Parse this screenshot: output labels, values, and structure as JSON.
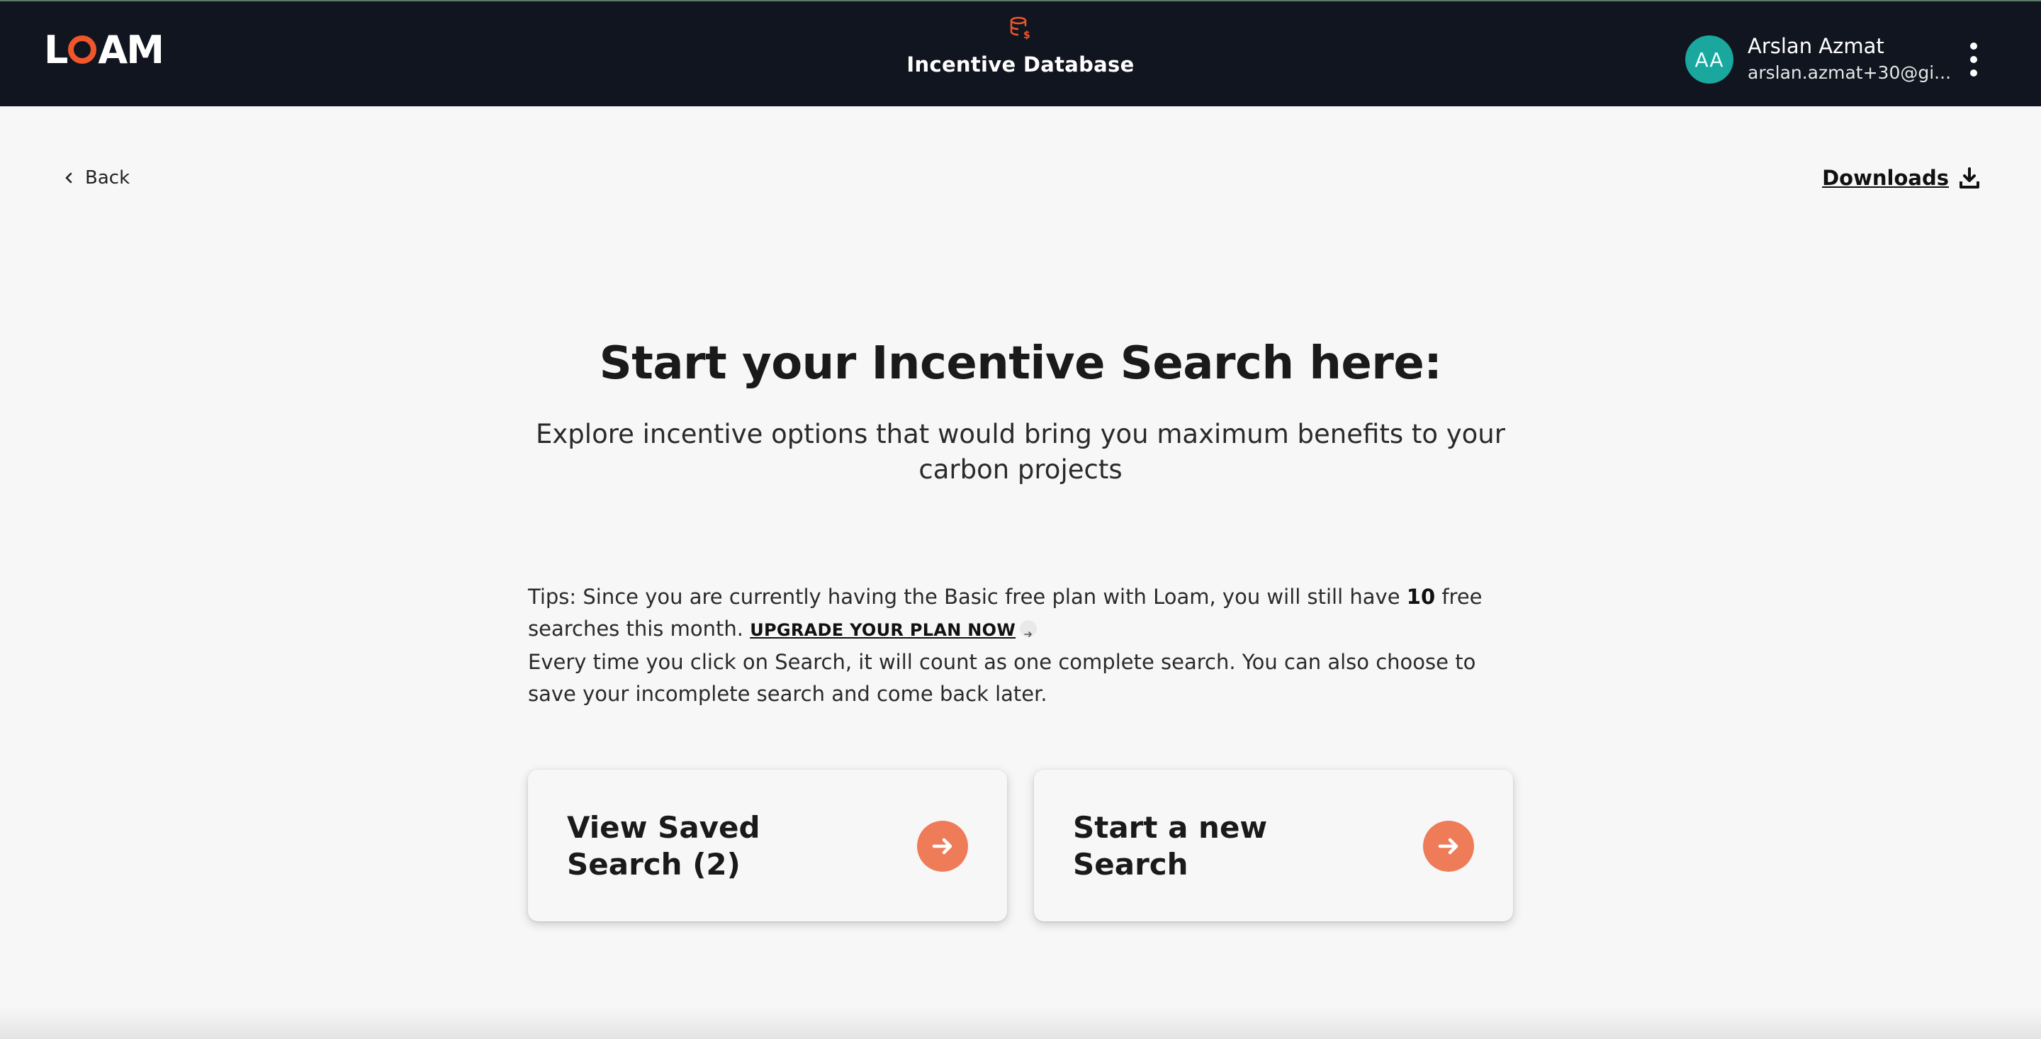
{
  "header": {
    "logo_text": "LOAM",
    "app_title": "Incentive Database",
    "user": {
      "initials": "AA",
      "name": "Arslan Azmat",
      "email": "arslan.azmat+30@gi..."
    },
    "colors": {
      "background": "#111520",
      "accent": "#f0562b",
      "avatar": "#1aa79e"
    },
    "icons": {
      "app": "database-dollar-icon",
      "menu": "kebab-menu-icon"
    }
  },
  "nav": {
    "back_label": "Back",
    "downloads_label": "Downloads",
    "icons": {
      "back": "chevron-left-icon",
      "downloads": "download-icon"
    }
  },
  "hero": {
    "title": "Start your Incentive Search here:",
    "subtitle": "Explore incentive options that would bring you maximum benefits to your carbon projects"
  },
  "tips": {
    "line1_before": "Tips: Since you are currently having the Basic free plan with Loam, you will still have ",
    "free_count": "10",
    "line1_after": " free searches this month. ",
    "upgrade_label": "UPGRADE YOUR PLAN NOW",
    "line2": "Every time you click on Search, it will count as one complete search. You can also choose to save your incomplete search and come back later."
  },
  "cards": [
    {
      "label": "View Saved Search (2)",
      "icon": "arrow-right-circle-icon"
    },
    {
      "label": "Start a new Search",
      "icon": "arrow-right-circle-icon"
    }
  ],
  "accent_color": "#ef7c58"
}
